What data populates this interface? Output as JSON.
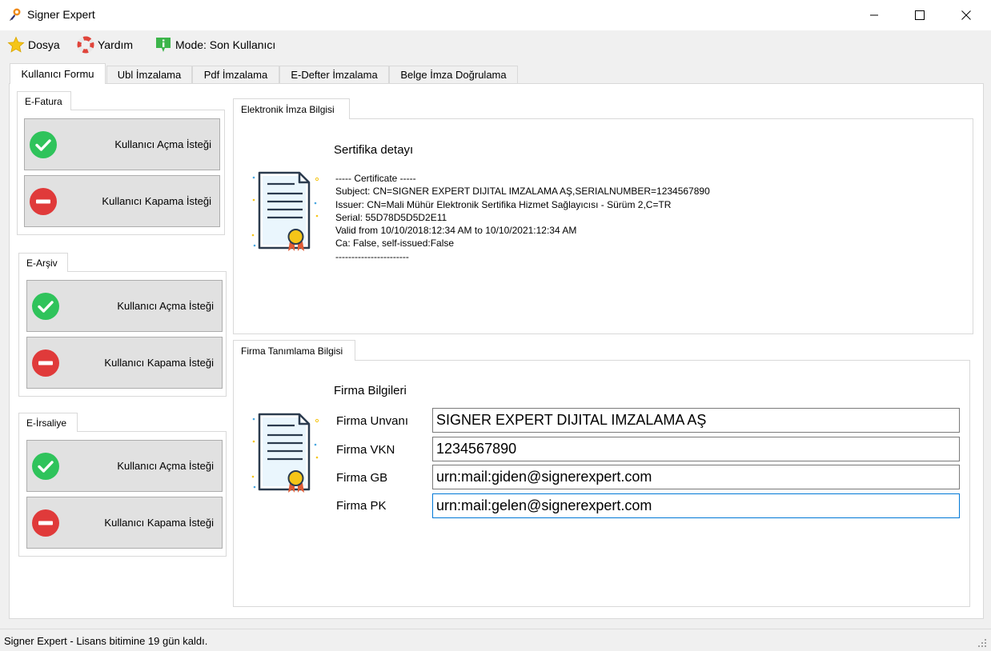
{
  "window": {
    "title": "Signer Expert"
  },
  "menu": {
    "file": "Dosya",
    "help": "Yardım",
    "mode": "Mode: Son Kullanıcı"
  },
  "tabs": [
    {
      "label": "Kullanıcı Formu",
      "active": true
    },
    {
      "label": "Ubl İmzalama"
    },
    {
      "label": "Pdf İmzalama"
    },
    {
      "label": "E-Defter İmzalama"
    },
    {
      "label": "Belge İmza Doğrulama"
    }
  ],
  "groups": [
    {
      "title": "E-Fatura",
      "open_label": "Kullanıcı Açma İsteği",
      "close_label": "Kullanıcı Kapama İsteği"
    },
    {
      "title": "E-Arşiv",
      "open_label": "Kullanıcı Açma İsteği",
      "close_label": "Kullanıcı Kapama İsteği"
    },
    {
      "title": "E-İrsaliye",
      "open_label": "Kullanıcı Açma İsteği",
      "close_label": "Kullanıcı Kapama İsteği"
    }
  ],
  "certificate": {
    "panel_title": "Elektronik İmza Bilgisi",
    "heading": "Sertifika detayı",
    "lines": [
      "----- Certificate -----",
      "Subject: CN=SIGNER EXPERT DIJITAL IMZALAMA AŞ,SERIALNUMBER=1234567890",
      "Issuer: CN=Mali Mühür Elektronik Sertifika Hizmet Sağlayıcısı - Sürüm 2,C=TR",
      "Serial: 55D78D5D5D2E11",
      "Valid from 10/10/2018:12:34 AM to 10/10/2021:12:34 AM",
      "Ca: False, self-issued:False",
      "-----------------------"
    ]
  },
  "company": {
    "panel_title": "Firma Tanımlama Bilgisi",
    "heading": "Firma Bilgileri",
    "fields": [
      {
        "label": "Firma Unvanı",
        "value": "SIGNER EXPERT DIJITAL IMZALAMA AŞ"
      },
      {
        "label": "Firma VKN",
        "value": "1234567890"
      },
      {
        "label": "Firma GB",
        "value": "urn:mail:giden@signerexpert.com"
      },
      {
        "label": "Firma PK",
        "value": "urn:mail:gelen@signerexpert.com"
      }
    ]
  },
  "status": {
    "text": "Signer Expert - Lisans bitimine 19 gün kaldı."
  },
  "colors": {
    "accent": "#0078d7",
    "success": "#2fc35b",
    "danger": "#e03a3a"
  }
}
